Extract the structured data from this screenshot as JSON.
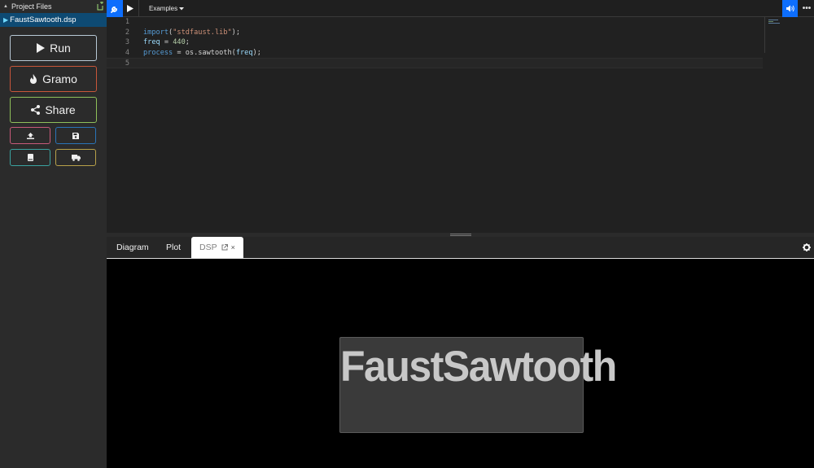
{
  "sidebar": {
    "header": "Project Files",
    "file": "FaustSawtooth.dsp",
    "run_label": "Run",
    "gramo_label": "Gramo",
    "share_label": "Share"
  },
  "toolbar": {
    "examples_label": "Examples"
  },
  "editor": {
    "line_numbers": [
      "1",
      "2",
      "3",
      "4",
      "5"
    ],
    "code": [
      "",
      "import(\"stdfaust.lib\");",
      "freq = 440;",
      "process = os.sawtooth(freq);",
      ""
    ],
    "tokens": {
      "l2_kw": "import",
      "l2_a": "(",
      "l2_str": "\"stdfaust.lib\"",
      "l2_b": ");",
      "l3_var": "freq",
      "l3_a": " = ",
      "l3_num": "440",
      "l3_b": ";",
      "l4_kw": "process",
      "l4_a": " = os.sawtooth(",
      "l4_var": "freq",
      "l4_b": ");"
    }
  },
  "tabs": {
    "diagram": "Diagram",
    "plot": "Plot",
    "dsp": "DSP",
    "close": "×"
  },
  "dsp": {
    "title": "FaustSawtooth"
  },
  "colors": {
    "accent": "#0d6efd",
    "run_border": "#b8c9d6",
    "gramo_border": "#c8563a",
    "share_border": "#8fc05a"
  }
}
